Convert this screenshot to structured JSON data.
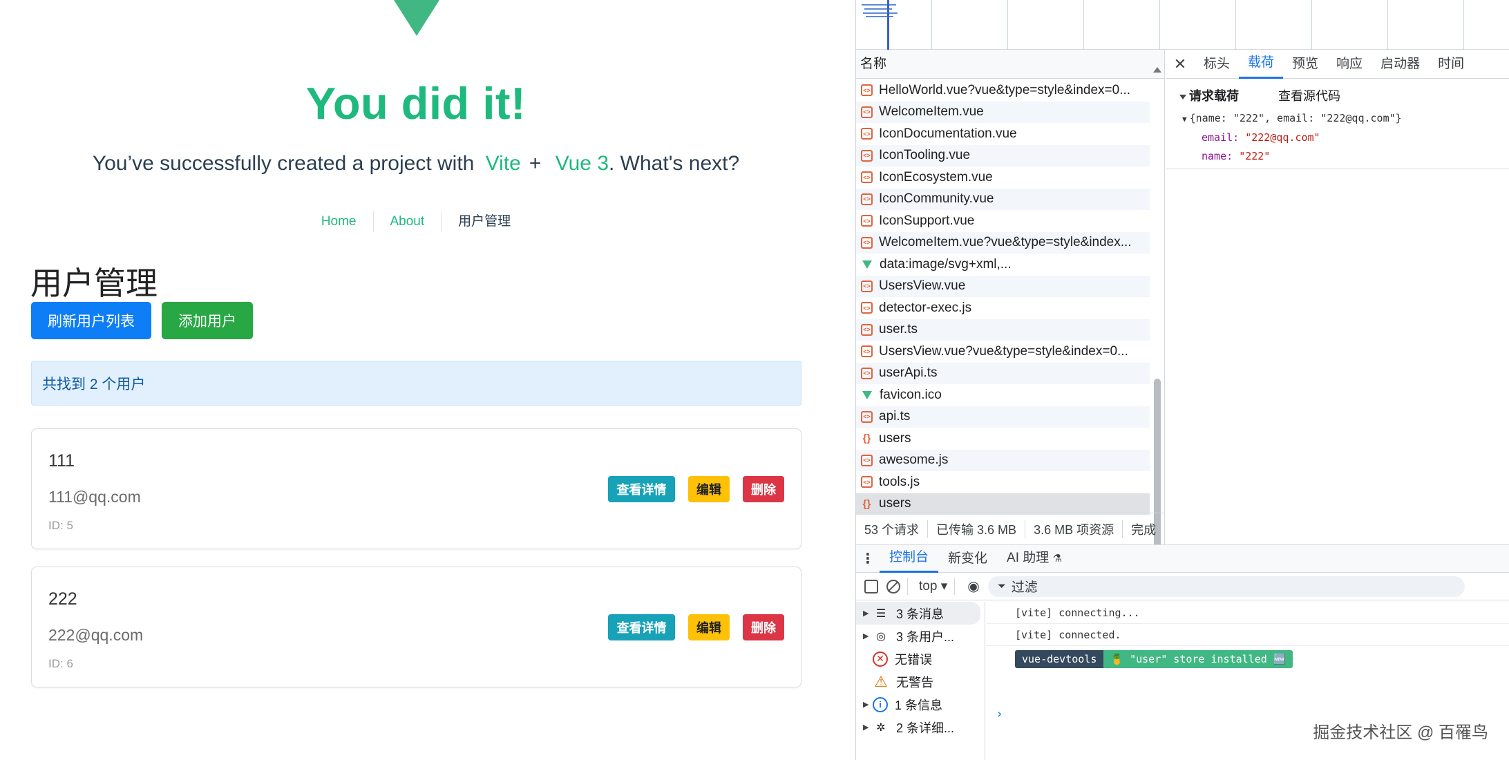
{
  "app": {
    "hero_title": "You did it!",
    "hero_sub_prefix": "You’ve successfully created a project with",
    "hero_link_vite": "Vite",
    "hero_plus": "+",
    "hero_link_vue": "Vue 3",
    "hero_sub_suffix": ". What's next?",
    "nav": [
      {
        "label": "Home"
      },
      {
        "label": "About"
      },
      {
        "label": "用户管理"
      }
    ],
    "page_title": "用户管理",
    "refresh_button": "刷新用户列表",
    "add_button": "添加用户",
    "alert_text": "共找到 2 个用户",
    "users": [
      {
        "name": "111",
        "email": "111@qq.com",
        "id": "ID: 5"
      },
      {
        "name": "222",
        "email": "222@qq.com",
        "id": "ID: 6"
      }
    ],
    "view_label": "查看详情",
    "edit_label": "编辑",
    "delete_label": "删除"
  },
  "devtools": {
    "name_header": "名称",
    "requests": [
      {
        "name": "HelloWorld.vue?vue&type=style&index=0...",
        "icon": "file-icon"
      },
      {
        "name": "WelcomeItem.vue",
        "icon": "file-icon"
      },
      {
        "name": "IconDocumentation.vue",
        "icon": "file-icon"
      },
      {
        "name": "IconTooling.vue",
        "icon": "file-icon"
      },
      {
        "name": "IconEcosystem.vue",
        "icon": "file-icon"
      },
      {
        "name": "IconCommunity.vue",
        "icon": "file-icon"
      },
      {
        "name": "IconSupport.vue",
        "icon": "file-icon"
      },
      {
        "name": "WelcomeItem.vue?vue&type=style&index...",
        "icon": "file-icon"
      },
      {
        "name": "data:image/svg+xml,...",
        "icon": "vue-icon"
      },
      {
        "name": "UsersView.vue",
        "icon": "file-icon"
      },
      {
        "name": "detector-exec.js",
        "icon": "file-icon"
      },
      {
        "name": "user.ts",
        "icon": "file-icon"
      },
      {
        "name": "UsersView.vue?vue&type=style&index=0...",
        "icon": "file-icon"
      },
      {
        "name": "userApi.ts",
        "icon": "file-icon"
      },
      {
        "name": "favicon.ico",
        "icon": "vue-icon"
      },
      {
        "name": "api.ts",
        "icon": "file-icon"
      },
      {
        "name": "users",
        "icon": "json-icon"
      },
      {
        "name": "awesome.js",
        "icon": "file-icon"
      },
      {
        "name": "tools.js",
        "icon": "file-icon"
      },
      {
        "name": "users",
        "icon": "json-icon"
      }
    ],
    "status": [
      "53 个请求",
      "已传输 3.6 MB",
      "3.6 MB 项资源",
      "完成"
    ],
    "detail_tabs": [
      "标头",
      "载荷",
      "预览",
      "响应",
      "启动器",
      "时间"
    ],
    "payload_title": "请求载荷",
    "payload_view_source": "查看源代码",
    "payload_summary": "{name: \"222\", email: \"222@qq.com\"}",
    "payload_email_key": "email:",
    "payload_email_val": "\"222@qq.com\"",
    "payload_name_key": "name:",
    "payload_name_val": "\"222\"",
    "console_tabs": [
      "控制台",
      "新变化",
      "AI 助理"
    ],
    "toolbar_top": "top ▾",
    "filter_placeholder": "过滤",
    "console_side": [
      {
        "label": "3 条消息",
        "icon": "list-icon",
        "arrow": true
      },
      {
        "label": "3 条用户...",
        "icon": "user-icon",
        "arrow": true
      },
      {
        "label": "无错误",
        "icon": "error-icon",
        "arrow": false
      },
      {
        "label": "无警告",
        "icon": "warning-icon",
        "arrow": false
      },
      {
        "label": "1 条信息",
        "icon": "info-icon",
        "arrow": true
      },
      {
        "label": "2 条详细...",
        "icon": "bug-icon",
        "arrow": true
      }
    ],
    "logs": [
      "[vite] connecting...",
      "[vite] connected."
    ],
    "badge_left": "vue-devtools",
    "badge_right": "🍍 \"user\" store installed 🆕",
    "watermark": "掘金技术社区 @ 百罹鸟"
  },
  "colors": {
    "vue_green": "#41b883",
    "primary_blue": "#0d7ef6",
    "success_green": "#28a745",
    "info_teal": "#17a2b8",
    "warning_yellow": "#ffc107",
    "danger_red": "#dc3545",
    "devtools_blue": "#1a73e8"
  }
}
